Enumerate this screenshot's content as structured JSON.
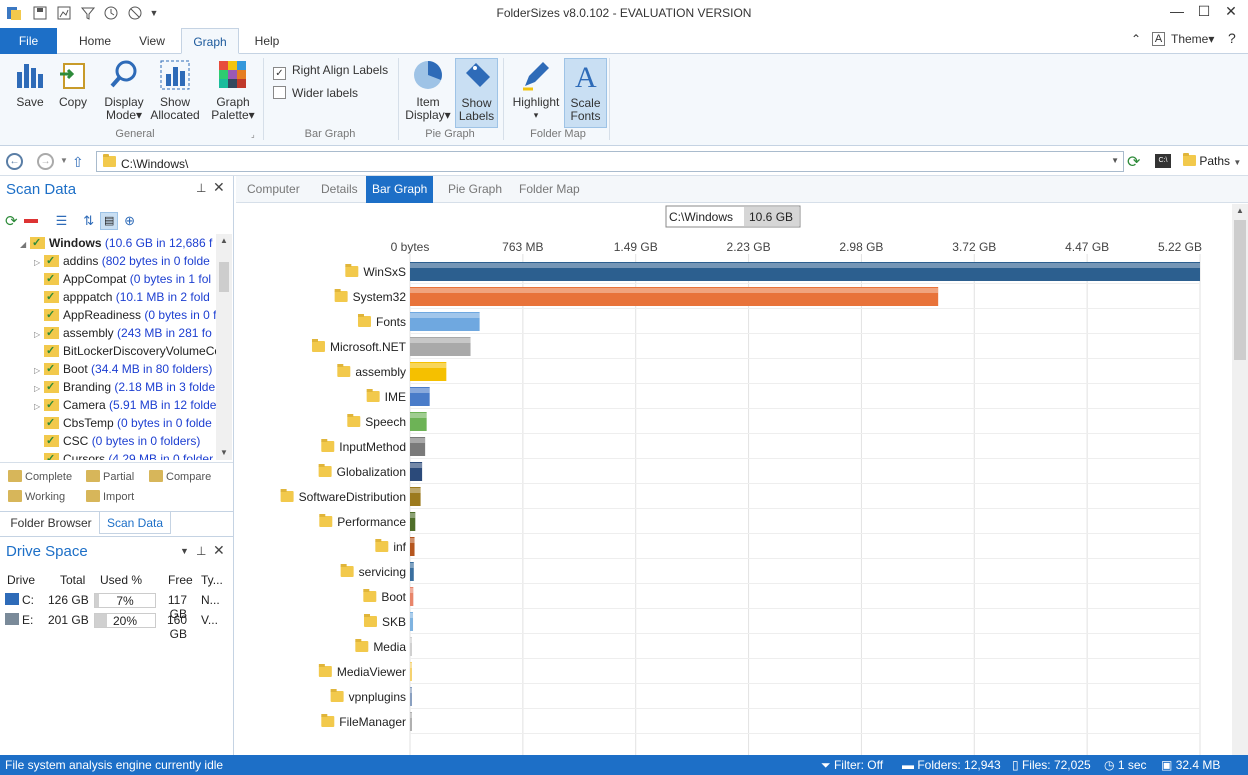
{
  "window": {
    "title": "FolderSizes v8.0.102 - EVALUATION VERSION"
  },
  "menu_tabs": [
    "File",
    "Home",
    "View",
    "Graph",
    "Help"
  ],
  "theme_label": "Theme",
  "ribbon": {
    "general": {
      "group": "General",
      "save": "Save",
      "copy": "Copy",
      "display_mode": [
        "Display",
        "Mode"
      ],
      "show_allocated": [
        "Show",
        "Allocated"
      ],
      "graph_palette": [
        "Graph",
        "Palette"
      ]
    },
    "bar_graph": {
      "group": "Bar Graph",
      "right_align": "Right Align Labels",
      "right_align_checked": true,
      "wider": "Wider labels",
      "wider_checked": false
    },
    "pie_graph": {
      "group": "Pie Graph",
      "item_display": [
        "Item",
        "Display"
      ],
      "show_labels": [
        "Show",
        "Labels"
      ]
    },
    "folder_map": {
      "group": "Folder Map",
      "highlight": "Highlight",
      "scale_fonts": [
        "Scale",
        "Fonts"
      ]
    }
  },
  "address": {
    "path": "C:\\Windows\\",
    "paths_label": "Paths"
  },
  "scan_panel": {
    "title": "Scan Data",
    "tree": [
      {
        "name": "Windows",
        "info": "(10.6 GB in 12,686 f",
        "root": true
      },
      {
        "name": "addins",
        "info": "(802 bytes in 0 folde"
      },
      {
        "name": "AppCompat",
        "info": "(0 bytes in 1 fol"
      },
      {
        "name": "apppatch",
        "info": "(10.1 MB in 2 fold"
      },
      {
        "name": "AppReadiness",
        "info": "(0 bytes in 0 f"
      },
      {
        "name": "assembly",
        "info": "(243 MB in 281 fo"
      },
      {
        "name": "BitLockerDiscoveryVolumeCo",
        "info": ""
      },
      {
        "name": "Boot",
        "info": "(34.4 MB in 80 folders)"
      },
      {
        "name": "Branding",
        "info": "(2.18 MB in 3 folde"
      },
      {
        "name": "Camera",
        "info": "(5.91 MB in 12 folde"
      },
      {
        "name": "CbsTemp",
        "info": "(0 bytes in 0 folde"
      },
      {
        "name": "CSC",
        "info": "(0 bytes in 0 folders)"
      },
      {
        "name": "Cursors",
        "info": "(4.29 MB in 0 folder"
      }
    ],
    "legend": [
      "Complete",
      "Partial",
      "Compare",
      "Working",
      "Import"
    ],
    "bottom_tabs": [
      "Folder Browser",
      "Scan Data"
    ]
  },
  "drive_panel": {
    "title": "Drive Space",
    "headers": [
      "Drive",
      "Total",
      "Used %",
      "Free",
      "Ty..."
    ],
    "rows": [
      {
        "drive": "C:",
        "total": "126 GB",
        "used": "7%",
        "used_frac": 0.07,
        "free": "117 GB",
        "type": "N..."
      },
      {
        "drive": "E:",
        "total": "201 GB",
        "used": "20%",
        "used_frac": 0.2,
        "free": "160 GB",
        "type": "V..."
      }
    ]
  },
  "view_tabs": [
    "Computer",
    "Details",
    "Bar Graph",
    "Pie Graph",
    "Folder Map"
  ],
  "chart_data": {
    "type": "bar",
    "orientation": "horizontal",
    "header_path": "C:\\Windows",
    "header_size": "10.6 GB",
    "tick_labels": [
      "0 bytes",
      "763 MB",
      "1.49 GB",
      "2.23 GB",
      "2.98 GB",
      "3.72 GB",
      "4.47 GB",
      "5.22 GB"
    ],
    "xlim_gb": [
      0,
      5.22
    ],
    "categories": [
      "WinSxS",
      "System32",
      "Fonts",
      "Microsoft.NET",
      "assembly",
      "IME",
      "Speech",
      "InputMethod",
      "Globalization",
      "SoftwareDistribution",
      "Performance",
      "inf",
      "servicing",
      "Boot",
      "SKB",
      "Media",
      "MediaViewer",
      "vpnplugins",
      "FileManager"
    ],
    "values_gb": [
      5.22,
      3.49,
      0.46,
      0.4,
      0.24,
      0.13,
      0.11,
      0.1,
      0.08,
      0.07,
      0.035,
      0.03,
      0.025,
      0.022,
      0.02,
      0.008,
      0.006,
      0.004,
      0.003
    ],
    "colors": [
      "#2c5f8f",
      "#e8733a",
      "#6fa8e0",
      "#a9a9a9",
      "#f5c000",
      "#4a7cc9",
      "#6db356",
      "#7a7a7a",
      "#2b4a7a",
      "#9c7a1e",
      "#4f6f2a",
      "#b5561f",
      "#3a6f9f",
      "#e8856a",
      "#7fb3e0",
      "#d0d0d0",
      "#f5d270",
      "#8aa0c0",
      "#b0b0b0"
    ]
  },
  "status": {
    "text": "File system analysis engine currently idle",
    "filter": "Filter: Off",
    "folders": "Folders: 12,943",
    "files": "Files: 72,025",
    "time": "1 sec",
    "memory": "32.4 MB"
  }
}
